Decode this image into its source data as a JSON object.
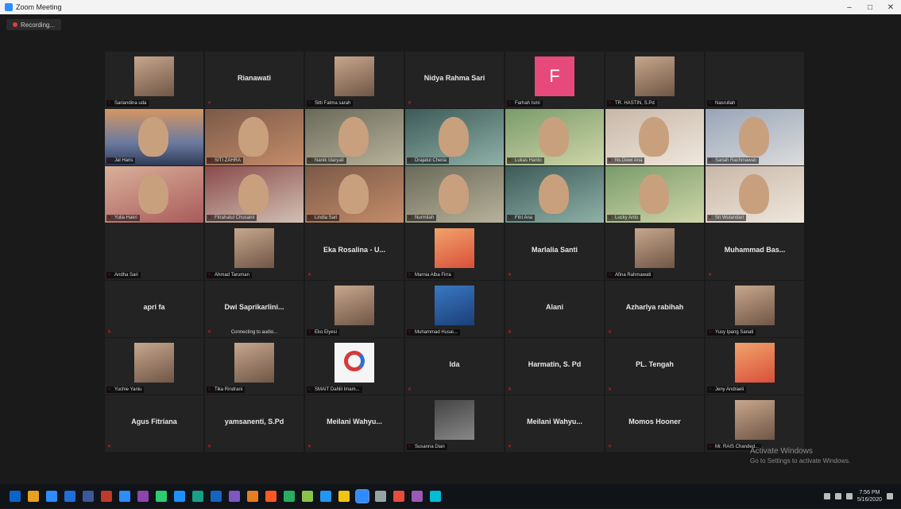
{
  "window": {
    "title": "Zoom Meeting",
    "minimize": "–",
    "maximize": "□",
    "close": "✕"
  },
  "recording": {
    "label": "Recording..."
  },
  "participants": [
    {
      "big": "",
      "small": "Sariandina uda",
      "pic": "photo"
    },
    {
      "big": "Rianawati",
      "small": "",
      "pic": ""
    },
    {
      "big": "",
      "small": "Sitti Fatma sarah",
      "pic": "photo"
    },
    {
      "big": "Nidya Rahma Sari",
      "small": "",
      "pic": ""
    },
    {
      "big": "",
      "small": "Farhah Ismi",
      "pic": "F"
    },
    {
      "big": "",
      "small": "TR. HASTIN, S.Pd",
      "pic": "photo"
    },
    {
      "big": "",
      "small": "Nasrullah",
      "pic": ""
    },
    {
      "big": "",
      "small": "Jal Haris",
      "pic": "video-sunset"
    },
    {
      "big": "",
      "small": "SITI ZAHRA",
      "pic": "video"
    },
    {
      "big": "",
      "small": "Nanik Idaryati",
      "pic": "video"
    },
    {
      "big": "",
      "small": "Drajatul Cheria",
      "pic": "video"
    },
    {
      "big": "",
      "small": "Lukas Hanto",
      "pic": "video"
    },
    {
      "big": "",
      "small": "Ns.Dewi Ana",
      "pic": "video"
    },
    {
      "big": "",
      "small": "Sariah Rachmawati",
      "pic": "video"
    },
    {
      "big": "",
      "small": "Yulia Hakri",
      "pic": "video"
    },
    {
      "big": "",
      "small": "Fitrahatul Chusaini",
      "pic": "video"
    },
    {
      "big": "",
      "small": "Lindia Sari",
      "pic": "video"
    },
    {
      "big": "",
      "small": "Nurmilah",
      "pic": "video"
    },
    {
      "big": "",
      "small": "Fitri Ana",
      "pic": "video"
    },
    {
      "big": "",
      "small": "Lucky Anto",
      "pic": "video"
    },
    {
      "big": "",
      "small": "Sri Wulandari",
      "pic": "video"
    },
    {
      "big": "",
      "small": "Andha Sari",
      "pic": ""
    },
    {
      "big": "",
      "small": "Ahmad Taruman",
      "pic": "photo"
    },
    {
      "big": "Eka Rosalina - U...",
      "small": "",
      "pic": ""
    },
    {
      "big": "",
      "small": "Marnia Alba Firra",
      "pic": "photo-red"
    },
    {
      "big": "Marlalia Santi",
      "small": "",
      "pic": ""
    },
    {
      "big": "",
      "small": "Afina Rahmawati",
      "pic": "photo"
    },
    {
      "big": "Muhammad Bas...",
      "small": "",
      "pic": ""
    },
    {
      "big": "apri fa",
      "small": "",
      "pic": ""
    },
    {
      "big": "Dwi Saprikarlini...",
      "small": "",
      "pic": "",
      "status": "Connecting to audio..."
    },
    {
      "big": "",
      "small": "Eko Elyesi",
      "pic": "photo"
    },
    {
      "big": "",
      "small": "Muhammad Husai...",
      "pic": "book"
    },
    {
      "big": "Alani",
      "small": "",
      "pic": ""
    },
    {
      "big": "Azharlya rabihah",
      "small": "",
      "pic": ""
    },
    {
      "big": "",
      "small": "Yusy Ipang Sanati",
      "pic": "photo"
    },
    {
      "big": "",
      "small": "Yuchie Yaniu",
      "pic": "photo"
    },
    {
      "big": "",
      "small": "Tika Rindrani",
      "pic": "photo"
    },
    {
      "big": "",
      "small": "SMAIT Dahlil Imam...",
      "pic": "logo"
    },
    {
      "big": "Ida",
      "small": "",
      "pic": ""
    },
    {
      "big": "Harmatin, S. Pd",
      "small": "",
      "pic": ""
    },
    {
      "big": "PL. Tengah",
      "small": "",
      "pic": ""
    },
    {
      "big": "",
      "small": "Jeny Andraeli",
      "pic": "red"
    },
    {
      "big": "Agus Fitriana",
      "small": "",
      "pic": ""
    },
    {
      "big": "yamsanenti, S.Pd",
      "small": "",
      "pic": ""
    },
    {
      "big": "Meilani Wahyu...",
      "small": "",
      "pic": ""
    },
    {
      "big": "",
      "small": "Susanna Dian",
      "pic": "dark"
    },
    {
      "big": "Meilani Wahyu...",
      "small": "",
      "pic": ""
    },
    {
      "big": "Momos Hooner",
      "small": "",
      "pic": ""
    },
    {
      "big": "",
      "small": "Mr. RAIS Chanded...",
      "pic": "photo"
    }
  ],
  "watermark": {
    "line1": "Activate Windows",
    "line2": "Go to Settings to activate Windows."
  },
  "taskbar": {
    "time": "7:56 PM",
    "date": "5/16/2020",
    "icon_colors": [
      "#0a64c8",
      "#e8a020",
      "#2d8cff",
      "#1e6fd9",
      "#3b5998",
      "#c0392b",
      "#2d8cff",
      "#8e44ad",
      "#2ecc71",
      "#1e90ff",
      "#16a085",
      "#1565c0",
      "#7e57c2",
      "#e67e22",
      "#ff5722",
      "#27ae60",
      "#8bc34a",
      "#2196f3",
      "#f1c40f",
      "#2d8cff",
      "#95a5a6",
      "#e74c3c",
      "#9b59b6",
      "#00bcd4"
    ]
  }
}
